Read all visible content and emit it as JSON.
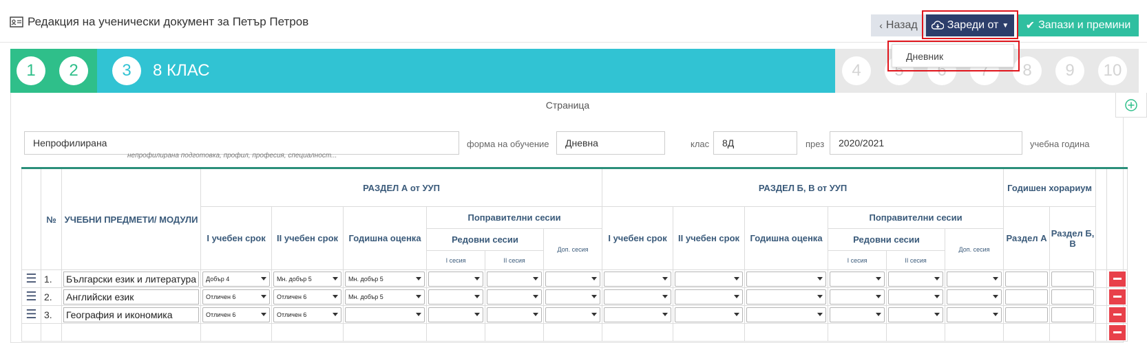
{
  "header": {
    "title": "Редакция на ученически документ за Петър Петров",
    "back_label": "Назад",
    "load_label": "Зареди от",
    "save_label": "Запази и премини",
    "dropdown_item": "Дневник"
  },
  "steps": {
    "numbers": [
      "1",
      "2",
      "3",
      "4",
      "5",
      "6",
      "7",
      "8",
      "9",
      "10"
    ],
    "active_label": "8 КЛАС",
    "current": 3
  },
  "page": {
    "label": "Страница",
    "profile_value": "Непрофилирана",
    "profile_hint": "непрофилирана подготовка, профил, професия, специалност...",
    "form_label": "форма на обучение",
    "form_value": "Дневна",
    "class_label": "клас",
    "class_value": "8Д",
    "through_label": "през",
    "year_value": "2020/2021",
    "year_label": "учебна година"
  },
  "table": {
    "col_no": "№",
    "col_subject": "УЧЕБНИ ПРЕДМЕТИ/ МОДУЛИ",
    "section_a": "РАЗДЕЛ А от УУП",
    "section_bv": "РАЗДЕЛ Б, В от УУП",
    "annual_hours": "Годишен хорариум",
    "term1": "I учебен срок",
    "term2": "II учебен срок",
    "annual_grade": "Годишна оценка",
    "corrective": "Поправителни сесии",
    "regular": "Редовни сесии",
    "extra": "Доп. сесия",
    "session1": "I сесия",
    "session2": "II сесия",
    "hours_a": "Раздел А",
    "hours_bv": "Раздел Б, В",
    "rows": [
      {
        "no": "1.",
        "subject": "Български език и литература",
        "t1": "Добър 4",
        "t2": "Мн. добър 5",
        "annual": "Мн. добър 5"
      },
      {
        "no": "2.",
        "subject": "Английски език",
        "t1": "Отличен 6",
        "t2": "Отличен 6",
        "annual": "Мн. добър 5"
      },
      {
        "no": "3.",
        "subject": "География и икономика",
        "t1": "Отличен 6",
        "t2": "Отличен 6",
        "annual": ""
      }
    ]
  },
  "colors": {
    "green": "#2fbf8a",
    "cyan": "#31c3d3",
    "navy": "#2c3e6b",
    "teal": "#2fbfa0",
    "red": "#e8404a",
    "highlight": "#e0141b"
  }
}
